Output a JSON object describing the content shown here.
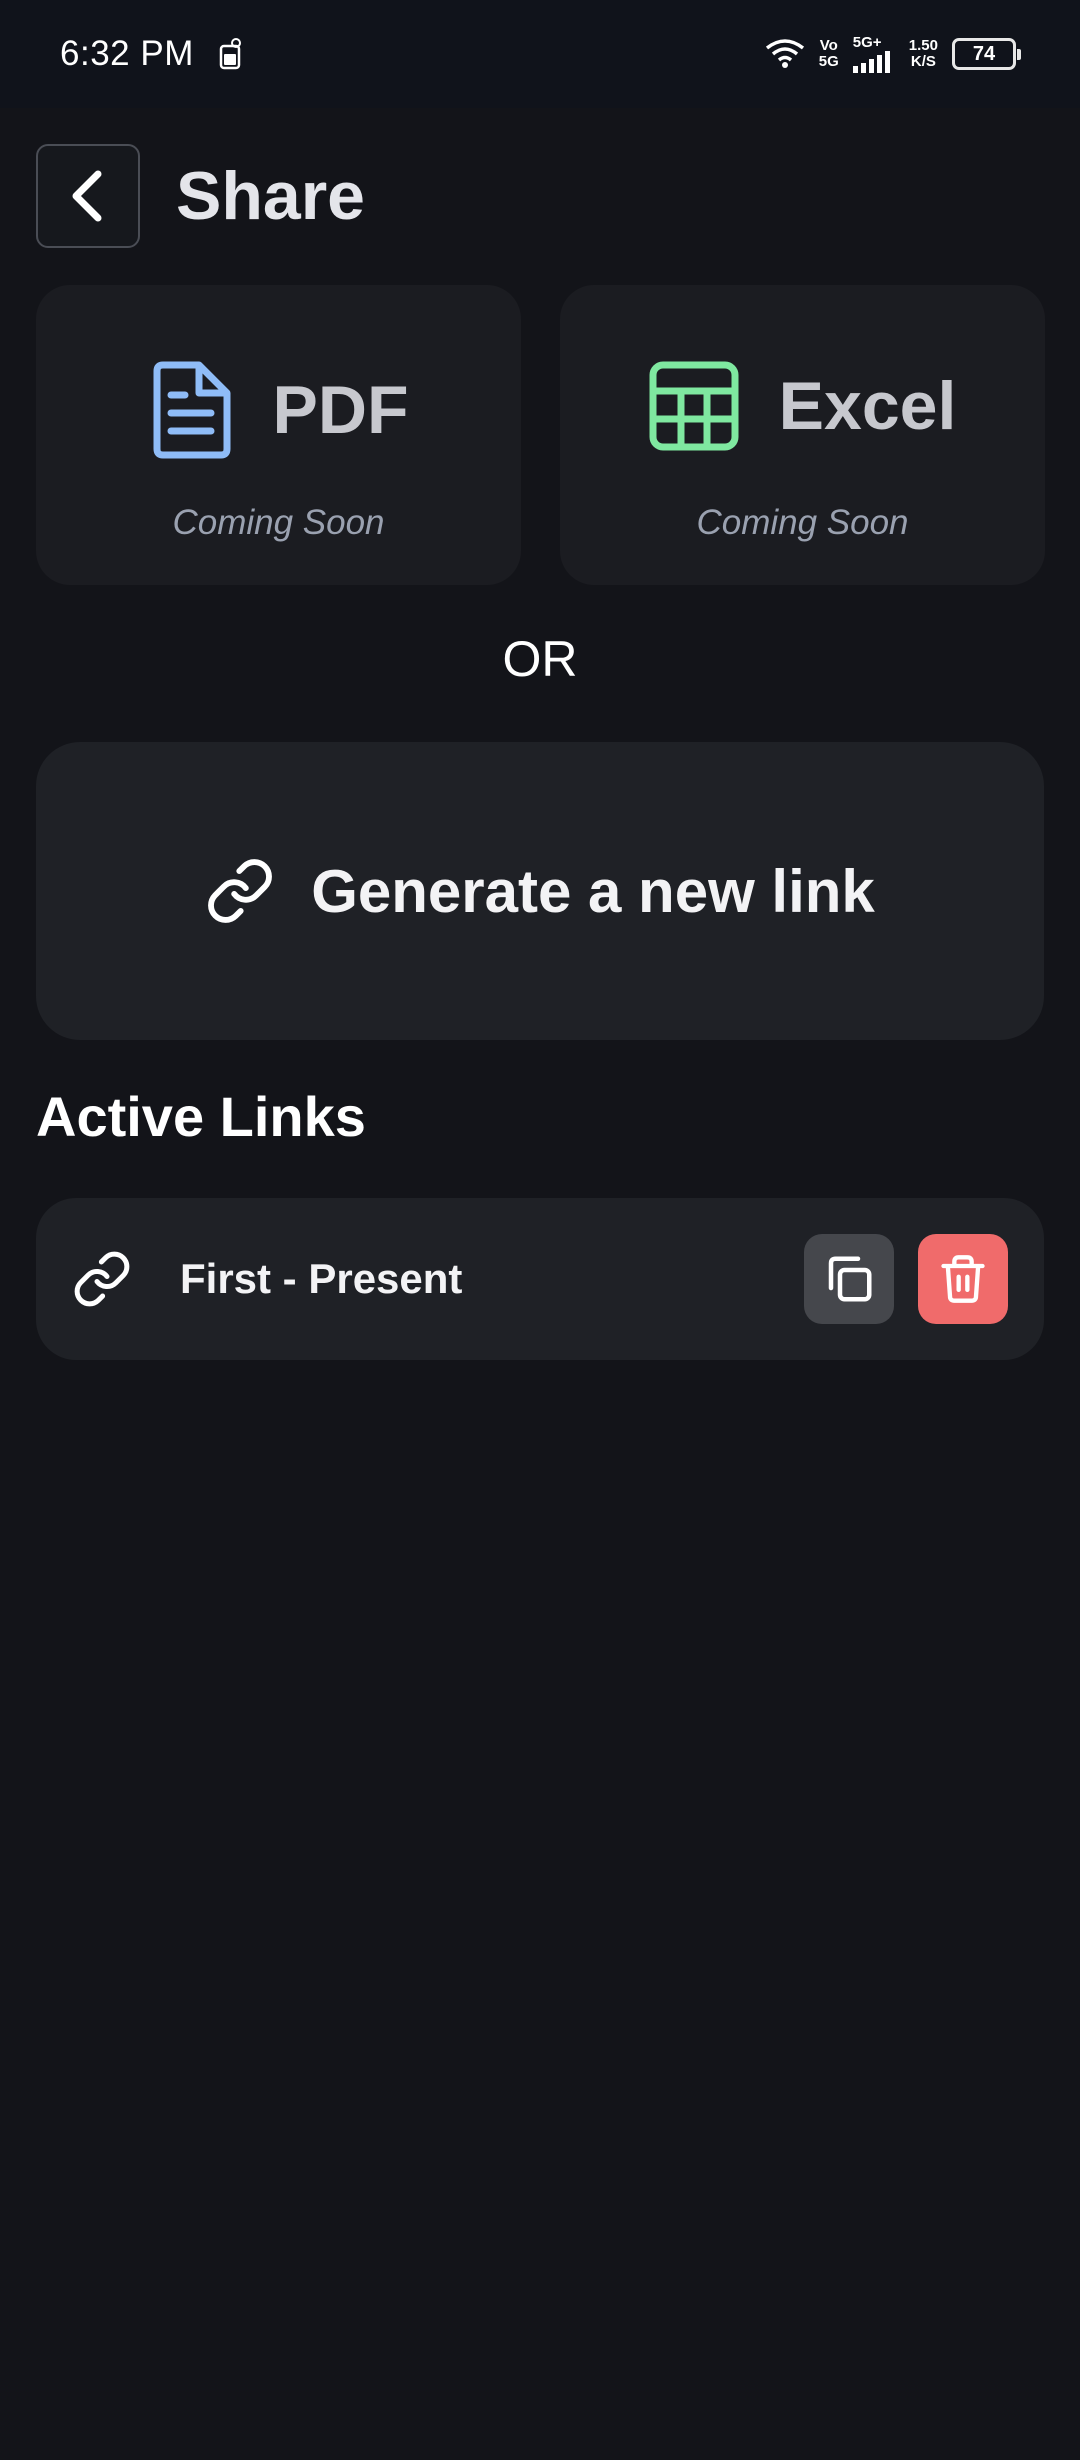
{
  "status_bar": {
    "time": "6:32 PM",
    "net_top": "Vo",
    "net_bottom": "5G",
    "signal_label": "5G+",
    "speed_top": "1.50",
    "speed_bottom": "K/S",
    "battery": "74"
  },
  "header": {
    "title": "Share",
    "back_icon": "chevron-left-icon"
  },
  "export_options": [
    {
      "label": "PDF",
      "status": "Coming Soon",
      "icon": "document-icon",
      "color": "#8fbcf7"
    },
    {
      "label": "Excel",
      "status": "Coming Soon",
      "icon": "table-icon",
      "color": "#7fe8a0"
    }
  ],
  "divider": "OR",
  "generate": {
    "label": "Generate a new link",
    "icon": "link-icon"
  },
  "active_links": {
    "title": "Active Links",
    "items": [
      {
        "label": "First - Present",
        "icon": "link-icon"
      }
    ]
  },
  "colors": {
    "background": "#131419",
    "card": "#1f2126",
    "delete": "#f06b6b",
    "copy": "#45474c"
  }
}
